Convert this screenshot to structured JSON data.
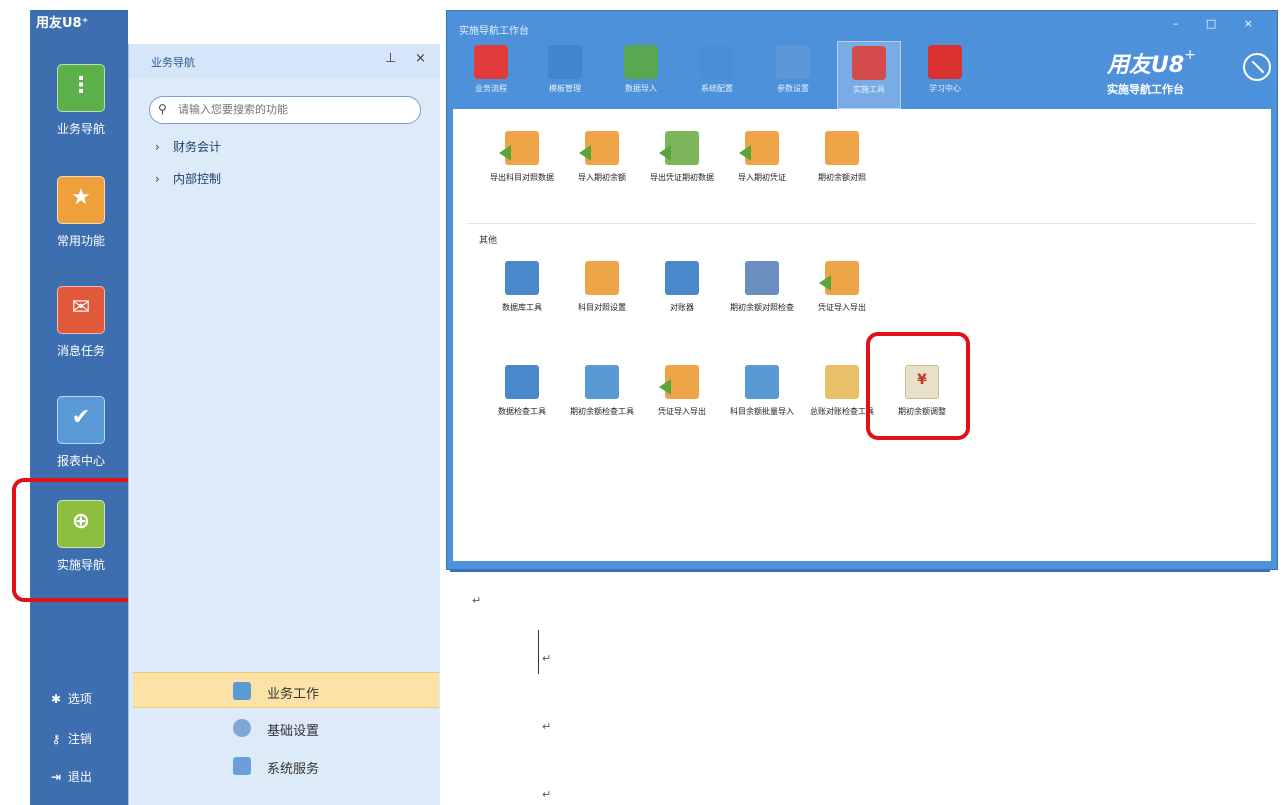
{
  "app": {
    "title": "用友U8⁺"
  },
  "rail": {
    "items": [
      {
        "label": "业务导航",
        "icon": "business-nav-icon",
        "color": "#5bb04a"
      },
      {
        "label": "常用功能",
        "icon": "star-icon",
        "color": "#f0a03a"
      },
      {
        "label": "消息任务",
        "icon": "message-icon",
        "color": "#e2583a"
      },
      {
        "label": "报表中心",
        "icon": "report-icon",
        "color": "#5b9bd5"
      },
      {
        "label": "实施导航",
        "icon": "implementation-nav-icon",
        "color": "#8cbf3f"
      }
    ],
    "bottom": [
      {
        "label": "选项",
        "icon": "gear-icon"
      },
      {
        "label": "注销",
        "icon": "key-icon"
      },
      {
        "label": "退出",
        "icon": "exit-icon"
      }
    ]
  },
  "tree": {
    "title": "业务导航",
    "search_placeholder": "请输入您要搜索的功能",
    "nodes": [
      "财务会计",
      "内部控制"
    ],
    "tabs": [
      "业务工作",
      "基础设置",
      "系统服务"
    ]
  },
  "dialog": {
    "title": "实施导航工作台",
    "controls": "– □ ×",
    "toolbar": [
      {
        "label": "业务流程",
        "color": "#e23b3b"
      },
      {
        "label": "模板管理",
        "color": "#3f86cf"
      },
      {
        "label": "数据导入",
        "color": "#58a852"
      },
      {
        "label": "系统配置",
        "color": "#4b8ed6"
      },
      {
        "label": "参数设置",
        "color": "#5d97d8"
      },
      {
        "label": "实施工具",
        "color": "#d24a4a"
      },
      {
        "label": "学习中心",
        "color": "#d93030"
      }
    ],
    "brand": {
      "name": "用友U8",
      "sup": "+",
      "sub": "实施导航工作台"
    },
    "tools_row1": [
      {
        "label": "导出科目对照数据",
        "color": "#f0a448"
      },
      {
        "label": "导入期初余额",
        "color": "#f0a448"
      },
      {
        "label": "导出凭证期初数据",
        "color": "#7cb55a"
      },
      {
        "label": "导入期初凭证",
        "color": "#f0a448"
      },
      {
        "label": "期初余额对照",
        "color": "#f0a448"
      }
    ],
    "section": "其他",
    "tools_row2": [
      {
        "label": "数据库工具",
        "color": "#4a88cc"
      },
      {
        "label": "科目对照设置",
        "color": "#f0a448"
      },
      {
        "label": "对账器",
        "color": "#4a88cc"
      },
      {
        "label": "期初余额对照检查",
        "color": "#6a8fc0"
      },
      {
        "label": "凭证导入导出",
        "color": "#f0a448"
      }
    ],
    "tools_row3": [
      {
        "label": "数据检查工具",
        "color": "#4a88cc"
      },
      {
        "label": "期初余额检查工具",
        "color": "#5a9ad4"
      },
      {
        "label": "凭证导入导出",
        "color": "#f0a448"
      },
      {
        "label": "科目余额批量导入",
        "color": "#5a9ad4"
      },
      {
        "label": "总账对账检查工具",
        "color": "#e8c06a"
      },
      {
        "label": "期初余额调整",
        "color": "#e8e0c8"
      }
    ]
  },
  "doc": {
    "marks": [
      "↵",
      "↵",
      "↵",
      "↵"
    ]
  }
}
